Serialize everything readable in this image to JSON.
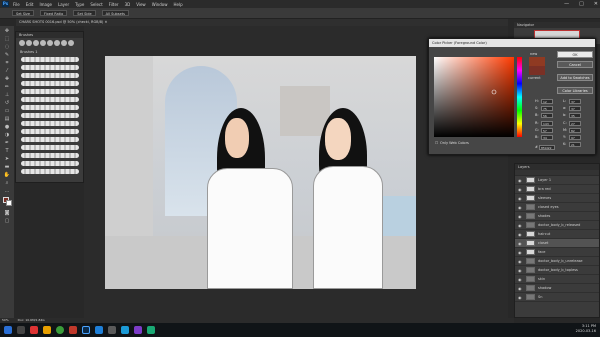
{
  "app": {
    "logo": "Ps",
    "menu": [
      "File",
      "Edit",
      "Image",
      "Layer",
      "Type",
      "Select",
      "Filter",
      "3D",
      "View",
      "Window",
      "Help"
    ],
    "window_controls": [
      "—",
      "□",
      "✕"
    ]
  },
  "options": {
    "fields": [
      "Set Size",
      "Fixed Ratio",
      "Set Side",
      "All Subsets"
    ]
  },
  "document": {
    "tab_label": "CHARS SHOTS 0016.psd @ 50% (checki, RGB/8) ✕"
  },
  "brushes_panel": {
    "title": "Brushes",
    "group": "Brushes 1"
  },
  "navigator": {
    "title": "Navigator"
  },
  "color_picker": {
    "title": "Color Picker (Foreground Color)",
    "ok": "OK",
    "cancel": "Cancel",
    "add_swatches": "Add to Swatches",
    "libraries": "Color Libraries",
    "new_label": "new",
    "current_label": "current",
    "only_web": "Only Web Colors",
    "hex_label": "#",
    "hex": "8f4d22",
    "fields": [
      {
        "label": "H:",
        "value": "12"
      },
      {
        "label": "S:",
        "value": "75"
      },
      {
        "label": "B:",
        "value": "56"
      },
      {
        "label": "R:",
        "value": "143"
      },
      {
        "label": "G:",
        "value": "57"
      },
      {
        "label": "B:",
        "value": "34"
      },
      {
        "label": "L:",
        "value": "37"
      },
      {
        "label": "a:",
        "value": "37"
      },
      {
        "label": "b:",
        "value": "35"
      },
      {
        "label": "C:",
        "value": "27"
      },
      {
        "label": "M:",
        "value": "82"
      },
      {
        "label": "Y:",
        "value": "97"
      },
      {
        "label": "K:",
        "value": "21"
      }
    ],
    "colors": {
      "new": "#8f3a22",
      "current": "#7a3025"
    }
  },
  "layers_panel": {
    "title": "Layers",
    "items": [
      "Layer 1",
      "bra red",
      "sleeves",
      "closed eyes",
      "shades",
      "doctor_body_b_released",
      "haircut",
      "closet",
      "face",
      "doctor_body_b_unrelease",
      "doctor_body_b_topless",
      "skin",
      "shadow",
      "Sn"
    ]
  },
  "status": {
    "zoom": "50%",
    "info": "Doc: 10.6M/1.84G"
  },
  "taskbar": {
    "time": "3:11 PM",
    "date": "2020-03-16"
  }
}
